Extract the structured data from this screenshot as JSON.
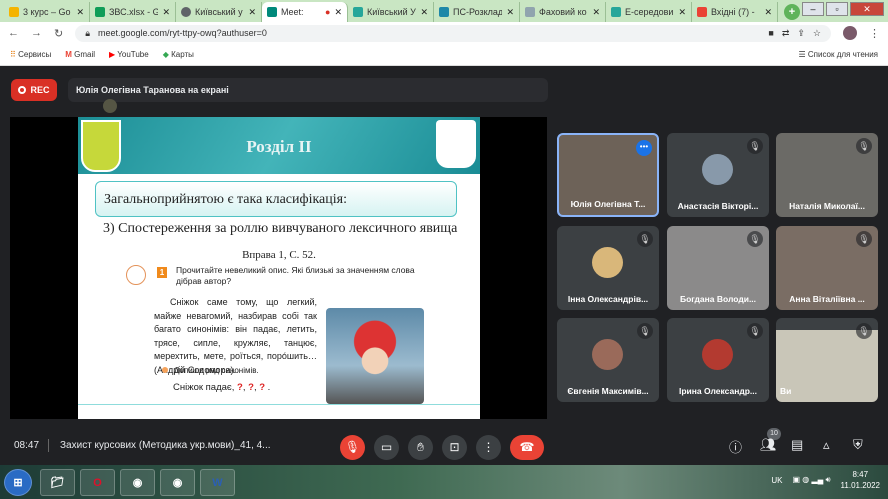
{
  "browser": {
    "tabs": [
      {
        "label": "3 курс – Go",
        "color": "#f4b400"
      },
      {
        "label": "ЗВС.xlsx - Go",
        "color": "#0f9d58"
      },
      {
        "label": "Київський у",
        "color": "#5f6368"
      },
      {
        "label": "Meet: ",
        "color": "#00897b",
        "active": true
      },
      {
        "label": "Київський У",
        "color": "#26a69a"
      },
      {
        "label": "ПС-Розклад",
        "color": "#1e88a8"
      },
      {
        "label": "Фаховий ко",
        "color": "#90a4ae"
      },
      {
        "label": "Е-середовищ",
        "color": "#26a69a"
      },
      {
        "label": "Вхідні (7) - ",
        "color": "#ea4335"
      }
    ],
    "url": "meet.google.com/ryt-ttpy-owq?authuser=0",
    "bookmarks": [
      "Сервисы",
      "Gmail",
      "YouTube",
      "Карты"
    ],
    "reading_list": "Список для чтения"
  },
  "meet": {
    "rec": "REC",
    "presenter": "Юлія Олегівна Таранова на екрані",
    "slide": {
      "title": "Розділ II",
      "box": "Загальноприйнятою є така класифікація:",
      "line3": "3) Спостереження за роллю вивчуваного лексичного явища",
      "exercise": "Вправа 1, С. 52.",
      "task_num": "1",
      "task": "Прочитайте невеликий опис. Які близькі за значенням слова дібрав автор?",
      "paragraph": "Сніжок саме тому, що легкий, майже невагомий, назбирав собі так багато синонімів: він падає, летить, трясе, сипле, кружляє, танцює, мерехтить, мете, роїться, порóшить… (Андрій Содомора).",
      "bullet": "Допиши ряд синонімів.",
      "answer_prefix": "Сніжок падає, ",
      "q": "?",
      "answer_sep": ", ",
      "answer_end": " ."
    },
    "participants": [
      {
        "name": "Юлія Олегівна Т..."
      },
      {
        "name": "Анастасія Вікторі..."
      },
      {
        "name": "Наталія Миколаї..."
      },
      {
        "name": "Інна Олександрів..."
      },
      {
        "name": "Богдана Володи..."
      },
      {
        "name": "Анна Віталіївна ..."
      },
      {
        "name": "Євгенія Максимів..."
      },
      {
        "name": "Ірина Олександр..."
      },
      {
        "name": "Ви"
      }
    ],
    "clock": "08:47",
    "meeting_title": "Захист курсових (Методика укр.мови)_41, 4...",
    "participant_count": "10",
    "accent": "#ea4335"
  },
  "taskbar": {
    "lang": "UK",
    "time": "8:47",
    "date": "11.01.2022"
  }
}
